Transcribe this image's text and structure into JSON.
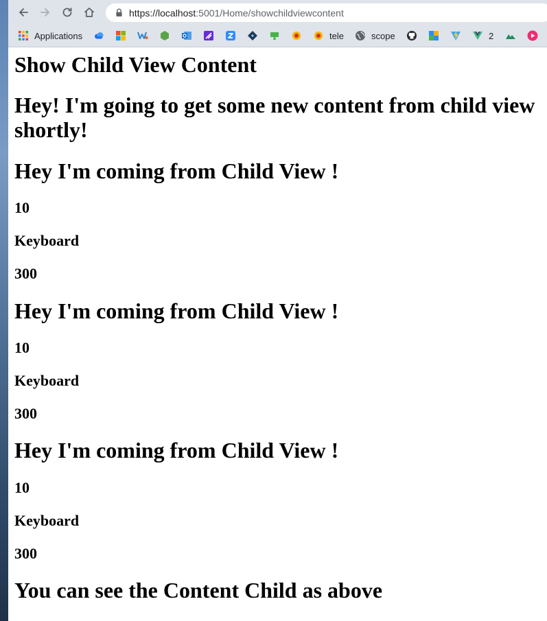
{
  "browser": {
    "url_host": "https://localhost",
    "url_rest": ":5001/Home/showchildviewcontent"
  },
  "bookmarks": {
    "applications": "Applications",
    "tele": "tele",
    "scope": "scope",
    "vue_count": "2"
  },
  "page": {
    "title": "Show Child View Content",
    "intro": "Hey! I'm going to get some new content from child view shortly!",
    "children": [
      {
        "heading": "Hey I'm coming from Child View !",
        "id": "10",
        "name": "Keyboard",
        "price": "300"
      },
      {
        "heading": "Hey I'm coming from Child View !",
        "id": "10",
        "name": "Keyboard",
        "price": "300"
      },
      {
        "heading": "Hey I'm coming from Child View !",
        "id": "10",
        "name": "Keyboard",
        "price": "300"
      }
    ],
    "footer": "You can see the Content Child as above"
  }
}
